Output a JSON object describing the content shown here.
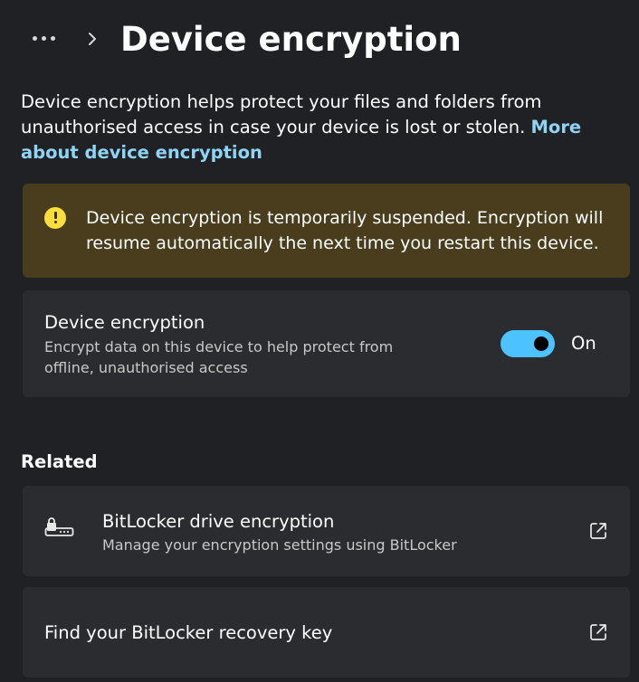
{
  "header": {
    "more_icon": "more-horizontal-icon",
    "chevron_icon": "chevron-right-icon",
    "title": "Device encryption"
  },
  "intro": {
    "text": "Device encryption helps protect your files and folders from unauthorised access in case your device is lost or stolen. ",
    "link": "More about device encryption"
  },
  "warning": {
    "icon": "warning-icon",
    "color": "#4a3d1d",
    "icon_color": "#f9de3c",
    "text": "Device encryption is temporarily suspended. Encryption will resume automatically the next time you restart this device."
  },
  "device_encryption": {
    "title": "Device encryption",
    "description": "Encrypt data on this device to help protect from offline, unauthorised access",
    "toggle_on": true,
    "toggle_state_label": "On",
    "accent_color": "#4cc2ff"
  },
  "related": {
    "label": "Related",
    "items": [
      {
        "icon": "bitlocker-lock-icon",
        "title": "BitLocker drive encryption",
        "description": "Manage your encryption settings using BitLocker",
        "action_icon": "open-external-icon"
      },
      {
        "title": "Find your BitLocker recovery key",
        "action_icon": "open-external-icon"
      }
    ]
  }
}
